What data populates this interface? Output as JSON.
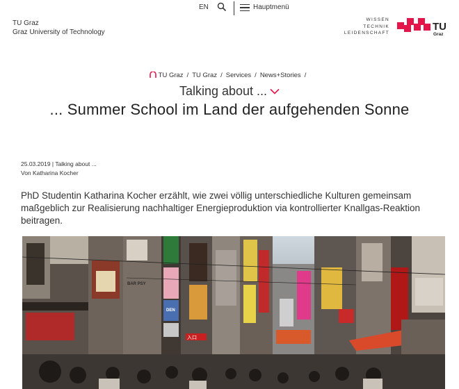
{
  "topbar": {
    "language": "EN",
    "menu_label": "Hauptmenü"
  },
  "university": {
    "name_de": "TU Graz",
    "name_en": "Graz University of Technology",
    "tagline": [
      "WISSEN",
      "TECHNIK",
      "LEIDENSCHAFT"
    ],
    "logo_text": "TU",
    "logo_subtext": "Graz"
  },
  "breadcrumb": [
    "TU Graz",
    "TU Graz",
    "Services",
    "News+Stories"
  ],
  "section": {
    "title": "Talking about ..."
  },
  "article": {
    "title": "... Summer School im Land der aufgehenden Sonne",
    "meta_line": "25.03.2019 | Talking about ...",
    "author": "Von Katharina Kocher",
    "lead": "PhD Studentin Katharina Kocher erzählt, wie zwei völlig unterschiedliche Kulturen gemeinsam maßgeblich zur Realisierung nachhaltiger Energieproduktion via kontrollierter Knallgas-Reaktion beitragen."
  },
  "photo_signs": [
    "BAR PSY",
    "DEN",
    "入口"
  ],
  "colors": {
    "brand_red": "#e4154b",
    "accent_chevron": "#e4154b",
    "text": "#222222"
  }
}
